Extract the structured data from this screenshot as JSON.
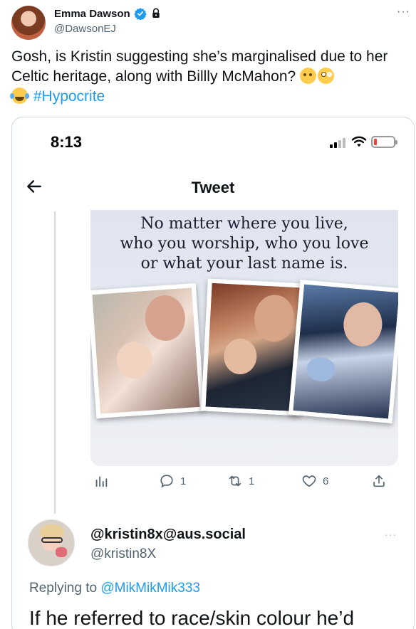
{
  "author": {
    "display_name": "Emma Dawson",
    "handle": "@DawsonEJ",
    "more": "···"
  },
  "tweet": {
    "text": "Gosh, is Kristin suggesting she’s marginalised due to her Celtic heritage, along with Billly McMahon?",
    "emojis": [
      "thinking-face",
      "face-with-rolling-eyes",
      "face-with-tears-of-joy"
    ],
    "hashtag": "#Hypocrite"
  },
  "embed": {
    "status_time": "8:13",
    "screen_title": "Tweet",
    "ad_caption": [
      "No matter where you live,",
      "who you worship, who you love",
      "or what your last name is."
    ],
    "actions": {
      "reply_count": "1",
      "retweet_count": "1",
      "like_count": "6"
    },
    "reply": {
      "name": "@kristin8x@aus.social",
      "handle": "@kristin8X",
      "more": "···",
      "replying_prefix": "Replying to",
      "replying_to": "@MikMikMik333",
      "body": "If he referred to race/skin colour he’d"
    }
  },
  "colors": {
    "accent": "#1d9bf0",
    "muted": "#536471",
    "border": "#cfd9de"
  }
}
